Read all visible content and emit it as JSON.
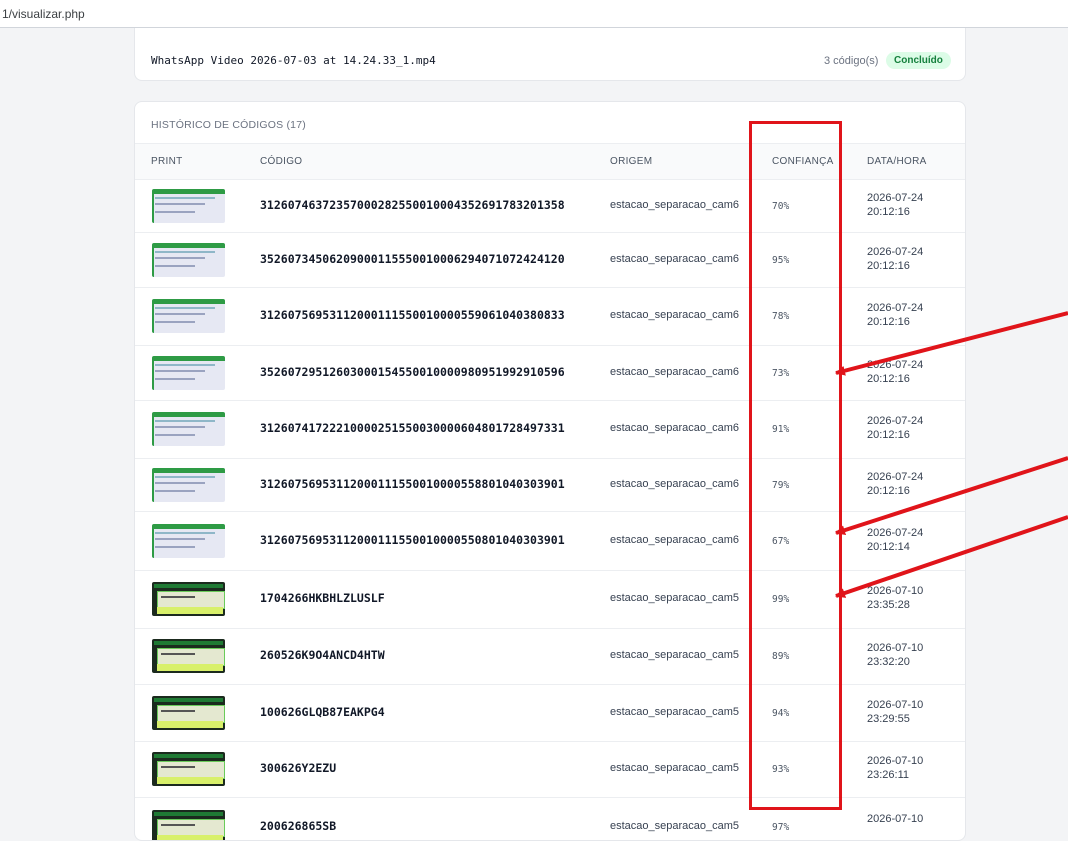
{
  "browser": {
    "url_text": "1/visualizar.php"
  },
  "file_card": {
    "name": "WhatsApp Video 2026-07-03 at 14.24.33_1.mp4",
    "count": "3 código(s)",
    "status": "Concluído"
  },
  "history": {
    "title": "HISTÓRICO DE CÓDIGOS (17)",
    "columns": {
      "print": "PRINT",
      "codigo": "CÓDIGO",
      "origem": "ORIGEM",
      "confianca": "CONFIANÇA",
      "datahora": "DATA/HORA"
    },
    "rows": [
      {
        "code": "31260746372357000282550010004352691783201358",
        "origem": "estacao_separacao_cam6",
        "conf": "70%",
        "date": "2026-07-24",
        "time": "20:12:16"
      },
      {
        "code": "35260734506209000115550010006294071072424120",
        "origem": "estacao_separacao_cam6",
        "conf": "95%",
        "date": "2026-07-24",
        "time": "20:12:16"
      },
      {
        "code": "31260756953112000111550010000559061040380833",
        "origem": "estacao_separacao_cam6",
        "conf": "78%",
        "date": "2026-07-24",
        "time": "20:12:16"
      },
      {
        "code": "35260729512603000154550010000980951992910596",
        "origem": "estacao_separacao_cam6",
        "conf": "73%",
        "date": "2026-07-24",
        "time": "20:12:16"
      },
      {
        "code": "31260741722210000251550030000604801728497331",
        "origem": "estacao_separacao_cam6",
        "conf": "91%",
        "date": "2026-07-24",
        "time": "20:12:16"
      },
      {
        "code": "31260756953112000111550010000558801040303901",
        "origem": "estacao_separacao_cam6",
        "conf": "79%",
        "date": "2026-07-24",
        "time": "20:12:16"
      },
      {
        "code": "31260756953112000111550010000550801040303901",
        "origem": "estacao_separacao_cam6",
        "conf": "67%",
        "date": "2026-07-24",
        "time": "20:12:14"
      },
      {
        "code": "1704266HKBHLZLUSLF",
        "origem": "estacao_separacao_cam5",
        "conf": "99%",
        "date": "2026-07-10",
        "time": "23:35:28"
      },
      {
        "code": "260526K9O4ANCD4HTW",
        "origem": "estacao_separacao_cam5",
        "conf": "89%",
        "date": "2026-07-10",
        "time": "23:32:20"
      },
      {
        "code": "100626GLQB87EAKPG4",
        "origem": "estacao_separacao_cam5",
        "conf": "94%",
        "date": "2026-07-10",
        "time": "23:29:55"
      },
      {
        "code": "300626Y2EZU",
        "origem": "estacao_separacao_cam5",
        "conf": "93%",
        "date": "2026-07-10",
        "time": "23:26:11"
      },
      {
        "code": "200626865SB",
        "origem": "estacao_separacao_cam5",
        "conf": "97%",
        "date": "2026-07-10",
        "time": ""
      }
    ]
  },
  "annotation_color": "#e0141a"
}
